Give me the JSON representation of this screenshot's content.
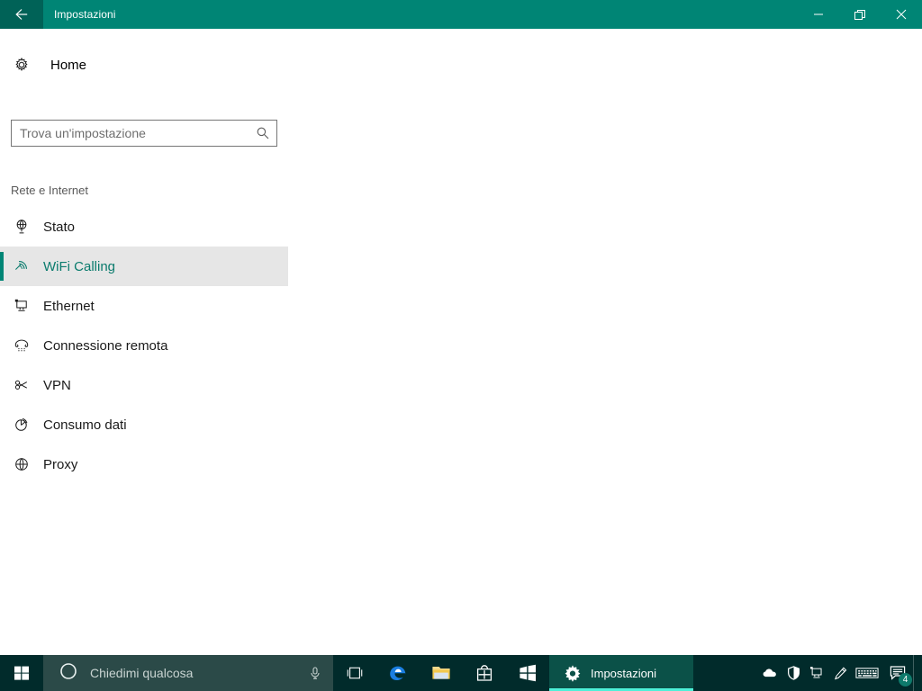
{
  "window": {
    "title": "Impostazioni",
    "back_icon": "back-arrow-icon",
    "minimize_label": "—",
    "restore_label": "restore-icon",
    "close_label": "✕",
    "accent_color": "#008575",
    "back_button_color": "#006257"
  },
  "nav": {
    "home_label": "Home",
    "home_icon": "gear-icon",
    "group_header": "Rete e Internet",
    "selected_color": "#0a7b6d",
    "selected_row_bg": "#e6e6e6",
    "items": [
      {
        "label": "Stato",
        "icon": "network-status-icon",
        "selected": false
      },
      {
        "label": "WiFi Calling",
        "icon": "wifi-icon",
        "selected": true
      },
      {
        "label": "Ethernet",
        "icon": "ethernet-icon",
        "selected": false
      },
      {
        "label": "Connessione remota",
        "icon": "dialup-phone-icon",
        "selected": false
      },
      {
        "label": "VPN",
        "icon": "vpn-key-icon",
        "selected": false
      },
      {
        "label": "Consumo dati",
        "icon": "pie-chart-icon",
        "selected": false
      },
      {
        "label": "Proxy",
        "icon": "globe-icon",
        "selected": false
      }
    ]
  },
  "search": {
    "placeholder": "Trova un'impostazione",
    "value": "",
    "icon": "search-icon"
  },
  "taskbar": {
    "background": "#012b2b",
    "start_icon": "windows-start-icon",
    "cortana": {
      "placeholder": "Chiedimi qualcosa",
      "circle_icon": "cortana-circle-icon",
      "mic_icon": "microphone-icon"
    },
    "buttons": [
      {
        "name": "task-view",
        "icon": "task-view-icon"
      },
      {
        "name": "edge",
        "icon": "edge-browser-icon"
      },
      {
        "name": "file-explorer",
        "icon": "folder-icon"
      },
      {
        "name": "microsoft-store",
        "icon": "store-bag-icon"
      },
      {
        "name": "windows-app",
        "icon": "windows-flag-icon"
      }
    ],
    "active_app": {
      "label": "Impostazioni",
      "icon": "gear-icon",
      "highlight_color": "#4df0d8"
    },
    "tray": [
      {
        "name": "onedrive",
        "icon": "cloud-icon"
      },
      {
        "name": "windows-defender",
        "icon": "shield-icon"
      },
      {
        "name": "network",
        "icon": "monitor-network-icon"
      },
      {
        "name": "pen-workspace",
        "icon": "pen-icon"
      },
      {
        "name": "touch-keyboard",
        "icon": "keyboard-icon"
      },
      {
        "name": "action-center",
        "icon": "notification-icon",
        "badge": "4"
      }
    ]
  }
}
